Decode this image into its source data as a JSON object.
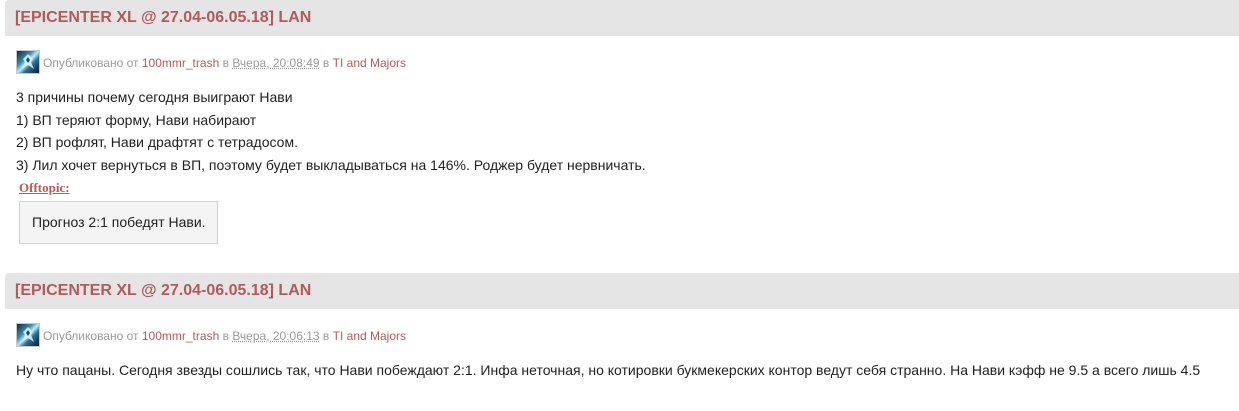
{
  "posts": [
    {
      "title": "[EPICENTER XL @ 27.04-06.05.18] LAN",
      "meta": {
        "published_prefix": "Опубликовано от",
        "author": "100mmr_trash",
        "in_word_1": "в",
        "date": "Вчера, 20:08:49",
        "in_word_2": "в",
        "category": "TI and Majors"
      },
      "lines": [
        "3 причины почему сегодня выиграют Нави",
        "1) ВП теряют форму, Нави набирают",
        "2) ВП рофлят, Нави драфтят с тетрадосом.",
        "3) Лил хочет вернуться в ВП, поэтому будет выкладываться на 146%. Роджер будет нервничать."
      ],
      "offtopic_label": "Offtopic:",
      "offtopic_text": "Прогноз 2:1 победят Нави."
    },
    {
      "title": "[EPICENTER XL @ 27.04-06.05.18] LAN",
      "meta": {
        "published_prefix": "Опубликовано от",
        "author": "100mmr_trash",
        "in_word_1": "в",
        "date": "Вчера, 20:06:13",
        "in_word_2": "в",
        "category": "TI and Majors"
      },
      "lines": [
        "Ну что пацаны. Сегодня звезды сошлись так, что Нави побеждают 2:1. Инфа неточная, но котировки букмекерских контор ведут себя странно. На Нави кэфф не 9.5  а всего лишь 4.5"
      ]
    }
  ],
  "icons": {
    "avatar": "avatar-icon"
  },
  "colors": {
    "title": "#b35a5a",
    "title_bar": "#e5e5e5",
    "link": "#b35a5a",
    "meta_text": "#9a9a9a",
    "offtopic_box": "#f4f4f4"
  }
}
